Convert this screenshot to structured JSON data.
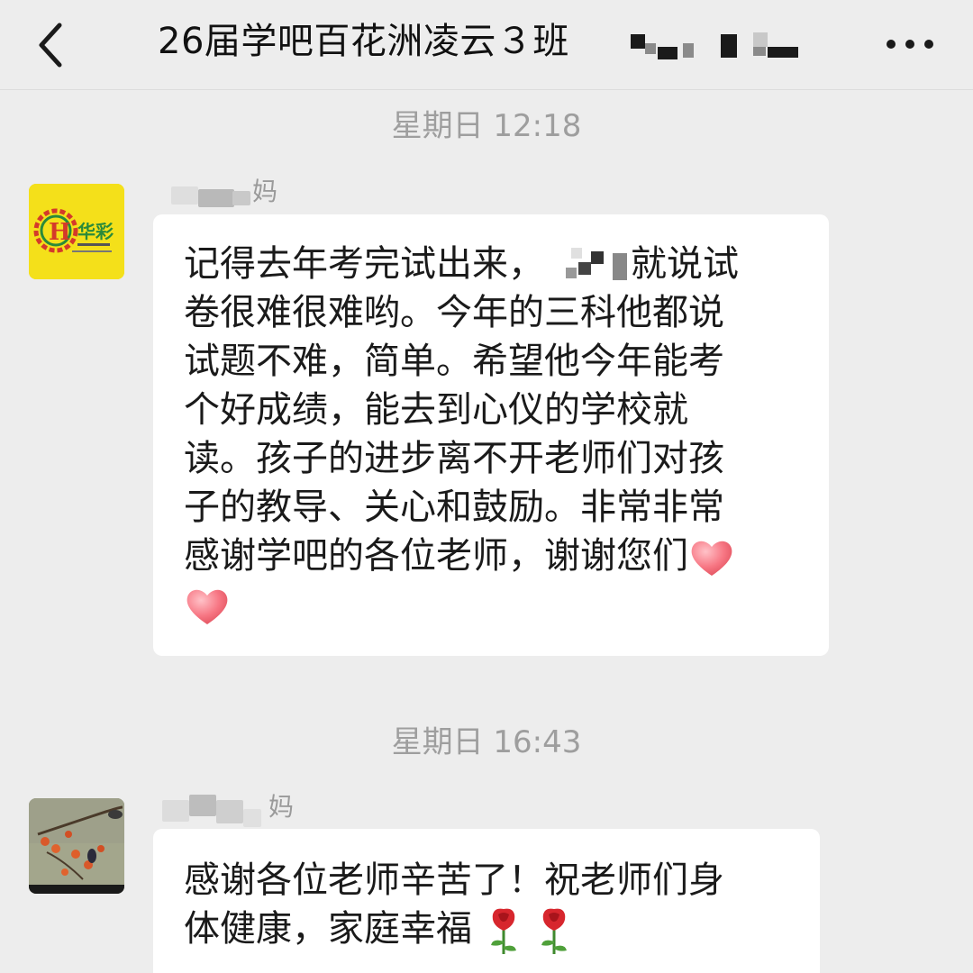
{
  "header": {
    "title": "26届学吧百花洲凌云３班",
    "back_icon": "chevron-left-icon",
    "more_icon": "more-dots-icon"
  },
  "messages": [
    {
      "timestamp": "星期日 12:18",
      "sender_suffix": "妈",
      "avatar": "huacai-logo-avatar",
      "avatar_text": "华彩",
      "lines": [
        "记得去年考完试出来，",
        "就说试",
        "卷很难很难哟。今年的三科他都说",
        "试题不难，简单。希望他今年能考",
        "个好成绩，能去到心仪的学校就",
        "读。孩子的进步离不开老师们对孩",
        "子的教导、关心和鼓励。非常非常",
        "感谢学吧的各位老师，谢谢您们"
      ],
      "emoji": "heart-emoji"
    },
    {
      "timestamp": "星期日 16:43",
      "sender_suffix": "妈",
      "avatar": "persimmon-bird-painting-avatar",
      "lines": [
        "感谢各位老师辛苦了！祝老师们身",
        "体健康，家庭幸福"
      ],
      "emoji": "rose-emoji"
    }
  ],
  "colors": {
    "background": "#ededed",
    "bubble": "#ffffff",
    "timestamp_text": "#9e9e9e",
    "avatar_yellow": "#f4e01a"
  }
}
